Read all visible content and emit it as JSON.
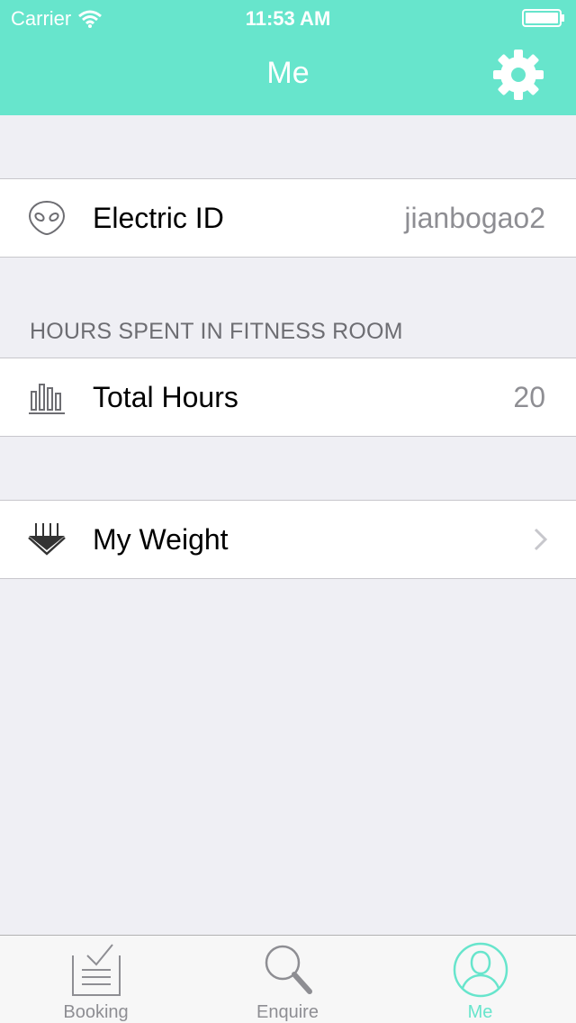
{
  "status_bar": {
    "carrier": "Carrier",
    "time": "11:53 AM",
    "icons": [
      "wifi-icon",
      "battery-icon"
    ]
  },
  "nav": {
    "title": "Me",
    "right_icon": "gear-icon"
  },
  "colors": {
    "accent": "#67e5cc",
    "background": "#efeff4",
    "secondary_text": "#8e8e93"
  },
  "electric_id_row": {
    "icon": "alien-face-icon",
    "label": "Electric ID",
    "value": "jianbogao2"
  },
  "fitness_section": {
    "header": "HOURS SPENT IN FITNESS ROOM",
    "total_hours_row": {
      "icon": "bar-chart-icon",
      "label": "Total Hours",
      "value": "20"
    }
  },
  "weight_row": {
    "icon": "weight-icon",
    "label": "My Weight",
    "accessory": "chevron-right-icon"
  },
  "tabbar": {
    "tabs": [
      {
        "label": "Booking",
        "icon": "booking-list-icon",
        "active": false
      },
      {
        "label": "Enquire",
        "icon": "magnifier-icon",
        "active": false
      },
      {
        "label": "Me",
        "icon": "person-circle-icon",
        "active": true
      }
    ]
  }
}
